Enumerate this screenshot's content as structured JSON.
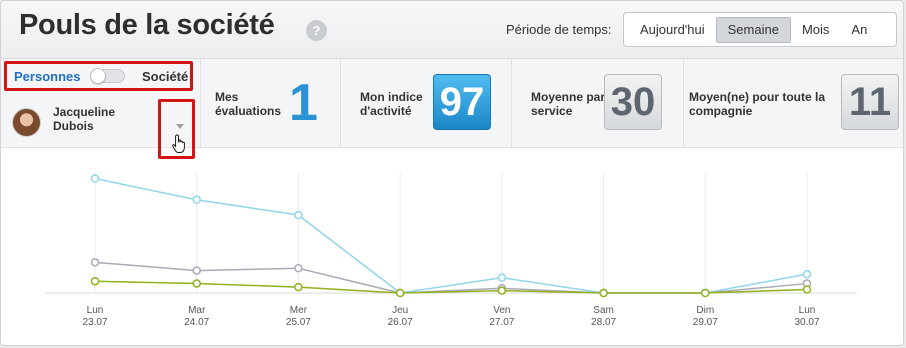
{
  "header": {
    "title": "Pouls de la société",
    "help_icon": "?",
    "period_label": "Période de temps:",
    "period_options": [
      "Aujourd'hui",
      "Semaine",
      "Mois",
      "An"
    ],
    "period_selected": "Semaine"
  },
  "scope_toggle": {
    "people_label": "Personnes",
    "company_label": "Société",
    "state": "Personnes"
  },
  "user": {
    "name": "Jacqueline Dubois",
    "avatar_icon": "avatar",
    "dropdown_icon": "chevron-down-icon",
    "cursor_icon": "hand-pointer-icon"
  },
  "stats": {
    "evaluations": {
      "label": "Mes évaluations",
      "value": "1"
    },
    "activity_index": {
      "label": "Mon indice d'activité",
      "value": "97"
    },
    "service_average": {
      "label": "Moyenne par service",
      "value": "30"
    },
    "company_average": {
      "label": "Moyen(ne) pour toute la compagnie",
      "value": "11"
    }
  },
  "colors": {
    "accent_blue": "#2a93d5",
    "series_light_blue": "#8fd6e8",
    "series_grey": "#a9a9b8",
    "series_olive": "#8fb21a",
    "highlight_red": "#d21414"
  },
  "chart_data": {
    "type": "line",
    "x": [
      {
        "day": "Lun",
        "date": "23.07"
      },
      {
        "day": "Mar",
        "date": "24.07"
      },
      {
        "day": "Mer",
        "date": "25.07"
      },
      {
        "day": "Jeu",
        "date": "26.07"
      },
      {
        "day": "Ven",
        "date": "27.07"
      },
      {
        "day": "Sam",
        "date": "28.07"
      },
      {
        "day": "Dim",
        "date": "29.07"
      },
      {
        "day": "Lun",
        "date": "30.07"
      }
    ],
    "ylim": [
      0,
      100
    ],
    "grid": true,
    "series": [
      {
        "color": "#8fd6e8",
        "values": [
          97,
          79,
          66,
          0,
          13,
          0,
          0,
          16
        ]
      },
      {
        "color": "#a9a9b8",
        "values": [
          26,
          19,
          21,
          0,
          4,
          0,
          0,
          8
        ]
      },
      {
        "color": "#8fb21a",
        "values": [
          10,
          8,
          5,
          0,
          2,
          0,
          0,
          3
        ]
      }
    ]
  }
}
